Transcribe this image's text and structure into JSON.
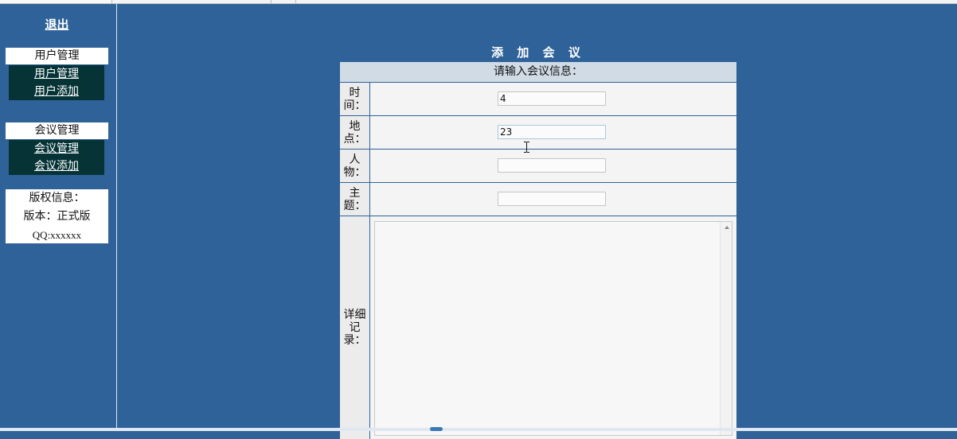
{
  "sidebar": {
    "logout_label": "退出",
    "user_menu": {
      "title": "用户管理",
      "items": [
        "用户管理",
        "用户添加"
      ]
    },
    "meeting_menu": {
      "title": "会议管理",
      "items": [
        "会议管理",
        "会议添加"
      ]
    },
    "copyright": {
      "title": "版权信息：",
      "version": "版本：正式版",
      "qq": "QQ:xxxxxx"
    }
  },
  "form": {
    "title": "添 加 会 议",
    "header": "请输入会议信息：",
    "fields": {
      "time": {
        "label_line1": "时",
        "label_line2": "间：",
        "value": "4"
      },
      "place": {
        "label_line1": "地",
        "label_line2": "点：",
        "value": "23"
      },
      "people": {
        "label_line1": "人",
        "label_line2": "物：",
        "value": ""
      },
      "topic": {
        "label_line1": "主",
        "label_line2": "题：",
        "value": ""
      },
      "details": {
        "label_line1": "详细",
        "label_line2": "记",
        "label_line3": "录：",
        "value": ""
      }
    }
  },
  "colors": {
    "background": "#2f6299",
    "menu_body": "#053336",
    "header_bg": "#d0dbe6"
  },
  "icons": [
    "text-cursor-icon",
    "scroll-up-arrow-icon"
  ]
}
